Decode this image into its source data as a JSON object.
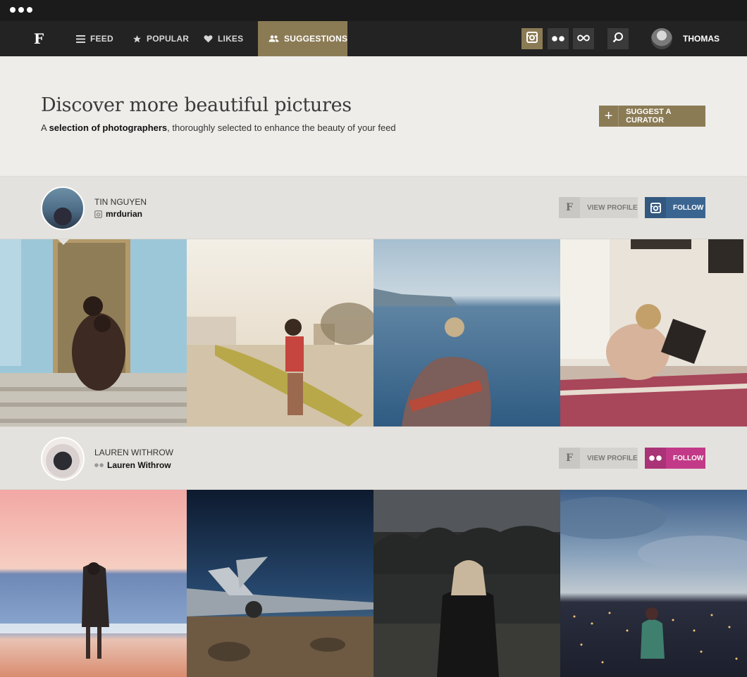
{
  "nav": {
    "logo": "F",
    "items": [
      {
        "label": "FEED",
        "icon": "menu-icon"
      },
      {
        "label": "POPULAR",
        "icon": "star-icon"
      },
      {
        "label": "LIKES",
        "icon": "heart-icon"
      },
      {
        "label": "SUGGESTIONS",
        "icon": "people-icon",
        "active": true
      }
    ],
    "sources": [
      "instagram-icon",
      "flickr-icon",
      "infinity-icon"
    ],
    "search_icon": "search-icon",
    "user_name": "THOMAS"
  },
  "hero": {
    "title": "Discover more beautiful pictures",
    "subtitle_pre": "A ",
    "subtitle_bold": "selection of photographers",
    "subtitle_post": ", thoroughly selected to enhance the beauty of your feed",
    "suggest_button": "SUGGEST A CURATOR"
  },
  "curators": [
    {
      "name": "TIN NGUYEN",
      "handle": "mrdurian",
      "source": "instagram",
      "view_profile": "VIEW PROFILE",
      "follow": "FOLLOW",
      "follow_color": "#3b6591",
      "photos": [
        "women-on-stairs",
        "surfer-girl-beach",
        "woman-ocean-blanket",
        "couple-on-bed"
      ]
    },
    {
      "name": "LAUREN WITHROW",
      "handle": "Lauren Withrow",
      "source": "flickr",
      "view_profile": "VIEW PROFILE",
      "follow": "FOLLOW",
      "follow_color": "#c23a87",
      "photos": [
        "woman-sunset-sea",
        "airplane-wreck-night",
        "woman-forest-dusk",
        "woman-city-lights"
      ]
    }
  ],
  "colors": {
    "accent": "#8b7b55",
    "nav_bg": "#232323",
    "page_bg": "#eeedea"
  }
}
